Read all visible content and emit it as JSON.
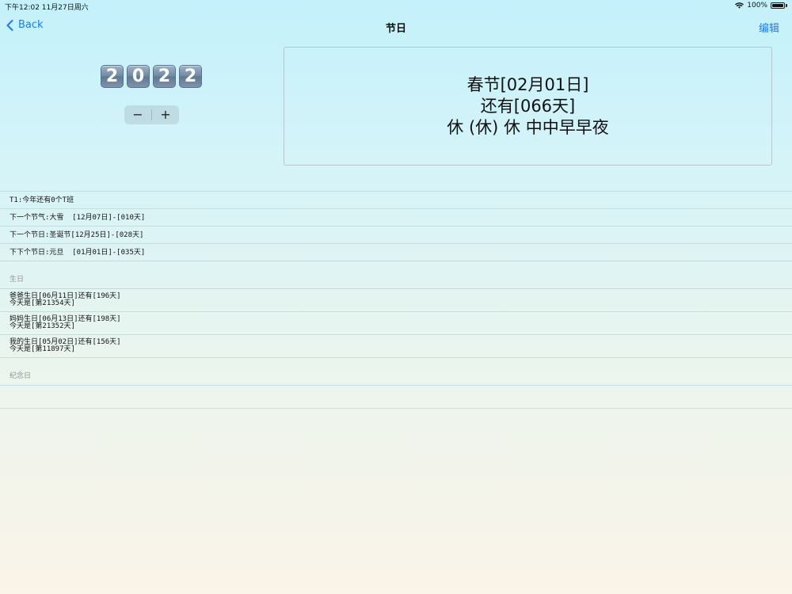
{
  "status_bar": {
    "time_date": "下午12:02   11月27日周六",
    "battery": "100%"
  },
  "nav": {
    "back_label": "Back",
    "title": "节日",
    "edit_label": "编辑"
  },
  "year": {
    "digits": [
      "2",
      "0",
      "2",
      "2"
    ],
    "minus": "−",
    "plus": "+"
  },
  "holiday_box": {
    "line1": "春节[02月01日]",
    "line2": "还有[066天]",
    "line3": "休 (休) 休 中中早早夜"
  },
  "summary_rows": [
    "T1:今年还有0个T班",
    "下一个节气:大雪  [12月07日]-[010天]",
    "下一个节日:圣诞节[12月25日]-[028天]",
    "下下个节日:元旦  [01月01日]-[035天]"
  ],
  "birthday_section": {
    "title": "生日",
    "items": [
      {
        "line1": "爸爸生日[06月11日]还有[196天]",
        "line2": "今天是[第21354天]"
      },
      {
        "line1": "妈妈生日[06月13日]还有[198天]",
        "line2": "今天是[第21352天]"
      },
      {
        "line1": "我的生日[05月02日]还有[156天]",
        "line2": "今天是[第11897天]"
      }
    ]
  },
  "anniversary_section": {
    "title": "纪念日"
  },
  "colors": {
    "accent": "#1a7cf5",
    "separator": "#c9dcdc"
  },
  "icons": [
    "wifi-icon",
    "battery-icon",
    "chevron-left-icon"
  ]
}
